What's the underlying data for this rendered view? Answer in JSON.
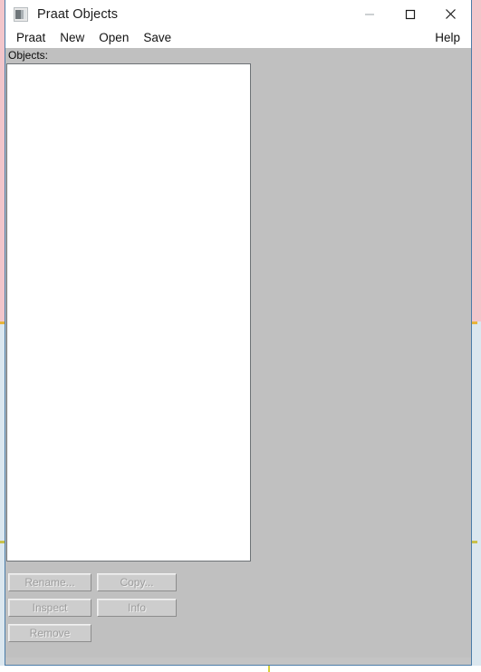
{
  "desktop": {
    "background_top_color": "#f2c6cb",
    "background_bottom_color": "#dbe7ef",
    "page_background": "#ffffff"
  },
  "window": {
    "title": "Praat Objects",
    "icon": "praat-app-icon",
    "border_color": "#4a7ca8",
    "client_background": "#c0c0c0",
    "titlebar_background": "#ffffff",
    "controls": [
      {
        "name": "minimize",
        "glyph": "minimize-icon",
        "label": "Minimize"
      },
      {
        "name": "maximize",
        "glyph": "maximize-icon",
        "label": "Maximize"
      },
      {
        "name": "close",
        "glyph": "close-icon",
        "label": "Close"
      }
    ]
  },
  "menubar": {
    "items": [
      {
        "label": "Praat"
      },
      {
        "label": "New"
      },
      {
        "label": "Open"
      },
      {
        "label": "Save"
      }
    ],
    "help_label": "Help"
  },
  "client": {
    "objects_label": "Objects:",
    "objects_list": {
      "items": [],
      "background": "#ffffff",
      "border_color": "#6d7276"
    }
  },
  "buttons": {
    "disabled_text_color": "#9d9d9d",
    "face_color": "#cdcdcd",
    "rows": [
      [
        {
          "label": "Rename...",
          "enabled": false
        },
        {
          "label": "Copy...",
          "enabled": false
        }
      ],
      [
        {
          "label": "Inspect",
          "enabled": false
        },
        {
          "label": "Info",
          "enabled": false
        }
      ],
      [
        {
          "label": "Remove",
          "enabled": false
        }
      ]
    ]
  }
}
